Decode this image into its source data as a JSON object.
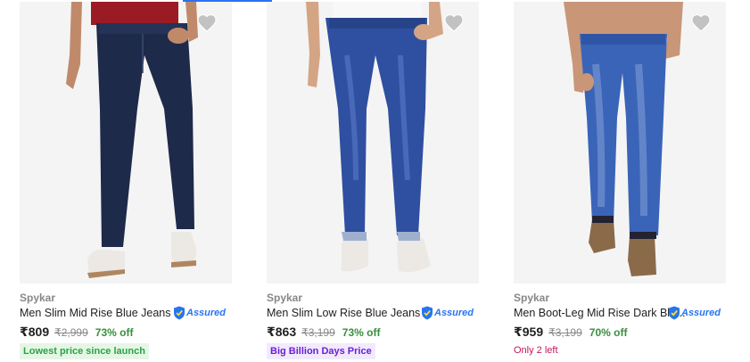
{
  "products": [
    {
      "brand": "Spykar",
      "title": "Men Slim Mid Rise Blue Jeans",
      "assured": "Assured",
      "price": "₹809",
      "mrp": "₹2,999",
      "discount": "73% off",
      "tag": "Lowest price since launch",
      "icons": [
        "heart-icon",
        "assured-shield-icon"
      ]
    },
    {
      "brand": "Spykar",
      "title": "Men Slim Low Rise Blue Jeans",
      "assured": "Assured",
      "price": "₹863",
      "mrp": "₹3,199",
      "discount": "73% off",
      "tag": "Big Billion Days Price",
      "icons": [
        "heart-icon",
        "assured-shield-icon"
      ]
    },
    {
      "brand": "Spykar",
      "title": "Men Boot-Leg Mid Rise Dark Blu...",
      "assured": "Assured",
      "price": "₹959",
      "mrp": "₹3,199",
      "discount": "70% off",
      "tag": "Only 2 left",
      "icons": [
        "heart-icon",
        "assured-shield-icon"
      ]
    }
  ],
  "colors": {
    "accent": "#2874f0",
    "discount_green": "#388e3c",
    "tag_green_bg": "#e6f6e6",
    "tag_purple_bg": "#f1eafd",
    "stock_pink": "#c2185b",
    "wishlist_grey": "#c2c2c2"
  }
}
